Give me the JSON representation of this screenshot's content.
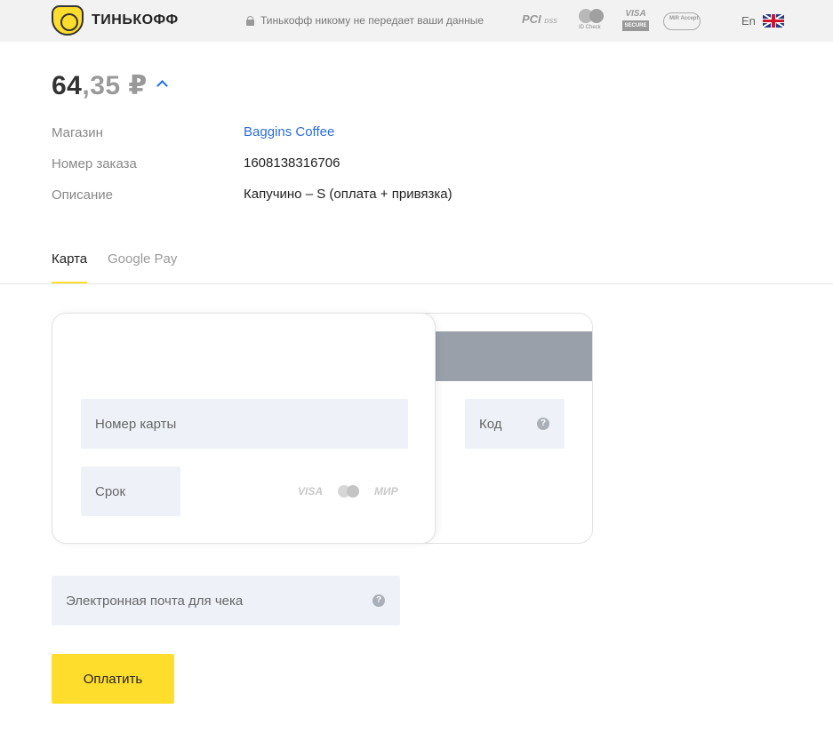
{
  "header": {
    "brand": "ТИНЬКОФФ",
    "privacy_note": "Тинькофф никому не передает ваши данные",
    "badges": {
      "pci": "PCI",
      "pci_small": "DSS",
      "mastercard": "ID Check",
      "visa": "VISA",
      "visa_secure": "SECURE",
      "mir": "MIR Accept"
    },
    "language": "En"
  },
  "amount": {
    "whole": "64",
    "fraction": ",35 ₽"
  },
  "details": [
    {
      "label": "Магазин",
      "value": "Baggins Coffee"
    },
    {
      "label": "Номер заказа",
      "value": "1608138316706"
    },
    {
      "label": "Описание",
      "value": "Капучино – S (оплата + привязка)"
    }
  ],
  "tabs": [
    {
      "label": "Карта",
      "active": true
    },
    {
      "label": "Google Pay",
      "active": false
    }
  ],
  "card_form": {
    "number_placeholder": "Номер карты",
    "expiry_placeholder": "Срок",
    "cvc_placeholder": "Код",
    "help_glyph": "?",
    "logos": {
      "visa": "VISA",
      "mir": "МИР"
    }
  },
  "email_placeholder": "Электронная почта для чека",
  "pay_button": "Оплатить",
  "colors": {
    "accent_yellow": "#ffdd2d",
    "link_blue": "#2b6ed8",
    "field_bg": "#eef2f8"
  }
}
